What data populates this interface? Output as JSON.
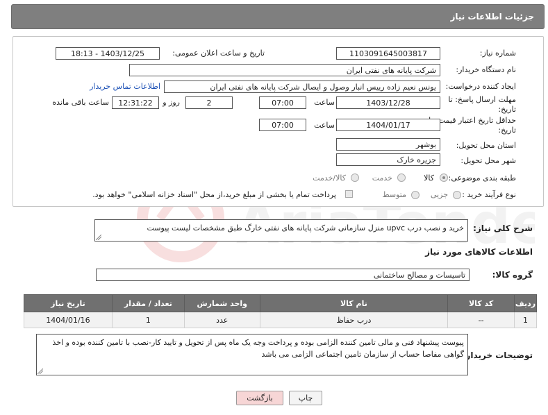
{
  "header": {
    "title": "جزئیات اطلاعات نیاز"
  },
  "form": {
    "need_number_label": "شماره نیاز:",
    "need_number": "1103091645003817",
    "announce_label": "تاریخ و ساعت اعلان عمومی:",
    "announce_value": "1403/12/25 - 18:13",
    "buyer_org_label": "نام دستگاه خریدار:",
    "buyer_org": "شرکت پایانه های نفتی ایران",
    "creator_label": "ایجاد کننده درخواست:",
    "creator": "یونس نعیم زاده رییس انبار وصول و ایصال شرکت پایانه های نفتی ایران",
    "contact_link": "اطلاعات تماس خریدار",
    "deadline_label_1": "مهلت ارسال پاسخ: تا",
    "deadline_label_2": "تاریخ:",
    "deadline_date": "1403/12/28",
    "time_label": "ساعت",
    "deadline_time": "07:00",
    "days_value": "2",
    "days_label": "روز و",
    "remaining_time": "12:31:22",
    "remaining_label": "ساعت باقی مانده",
    "validity_label_1": "حداقل تاریخ اعتبار قیمت: تا",
    "validity_label_2": "تاریخ:",
    "validity_date": "1404/01/17",
    "validity_time": "07:00",
    "province_label": "استان محل تحویل:",
    "province": "بوشهر",
    "city_label": "شهر محل تحویل:",
    "city": "جزیره خارک",
    "category_label": "طبقه بندی موضوعی:",
    "category_options": [
      "کالا",
      "خدمت",
      "کالا/خدمت"
    ],
    "purchase_type_label": "نوع فرآیند خرید :",
    "purchase_options": [
      "جزیی",
      "متوسط"
    ],
    "treasury_note": "پرداخت تمام یا بخشی از مبلغ خرید،از محل \"اسناد خزانه اسلامی\" خواهد بود."
  },
  "summary": {
    "label": "شرح کلی نیاز:",
    "text": "خرید و نصب درب upvc منزل سازمانی شرکت پایانه های نفتی خارگ طبق مشخصات لیست پیوست"
  },
  "goods": {
    "section_title": "اطلاعات کالاهای مورد نیاز",
    "group_label": "گروه کالا:",
    "group_value": "تاسیسات و مصالح ساختمانی",
    "columns": [
      "ردیف",
      "کد کالا",
      "نام کالا",
      "واحد شمارش",
      "تعداد / مقدار",
      "تاریخ نیاز"
    ],
    "rows": [
      {
        "row": "1",
        "code": "--",
        "name": "درب حفاظ",
        "unit": "عدد",
        "qty": "1",
        "date": "1404/01/16"
      }
    ]
  },
  "buyer_notes": {
    "label": "توضیحات خریدار:",
    "text": "پیوست پیشنهاد فنی و مالی تامین کننده الزامی بوده و پرداخت وجه یک ماه پس از تحویل و تایید کار-نصب با تامین کننده بوده و اخذ گواهی مفاصا حساب از سازمان تامین اجتماعی الزامی می باشد"
  },
  "buttons": {
    "print": "چاپ",
    "back": "بازگشت"
  },
  "colors": {
    "header_bg": "#7f7f7f",
    "link": "#1a4fb5",
    "back_button_bg": "#f7d6d6",
    "table_header": "#707070"
  }
}
